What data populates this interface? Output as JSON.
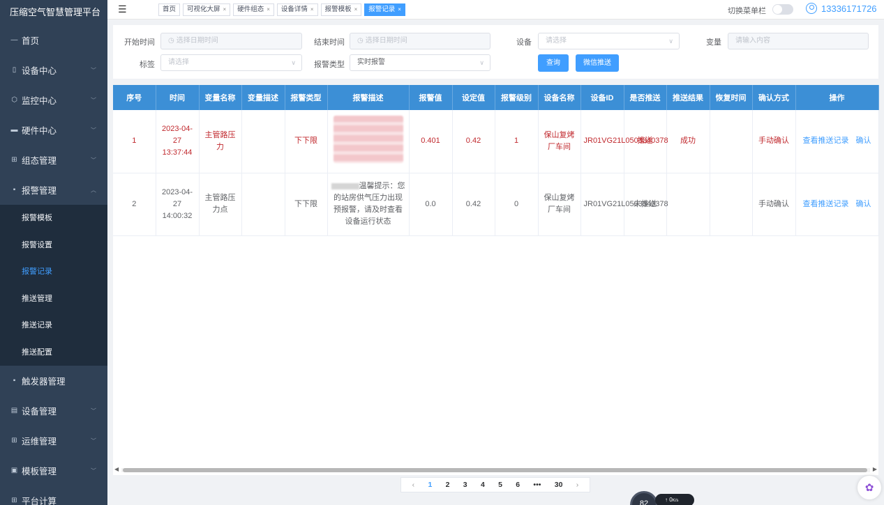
{
  "app": {
    "title": "压缩空气智慧管理平台"
  },
  "sidebar": {
    "items": [
      {
        "label": "首页",
        "icon": "—",
        "has_children": false
      },
      {
        "label": "设备中心",
        "icon": "▯",
        "has_children": true
      },
      {
        "label": "监控中心",
        "icon": "⬡",
        "has_children": true
      },
      {
        "label": "硬件中心",
        "icon": "▬",
        "has_children": true
      },
      {
        "label": "组态管理",
        "icon": "⊞",
        "has_children": true
      },
      {
        "label": "报警管理",
        "icon": "▪",
        "has_children": true,
        "expanded": true
      }
    ],
    "sub_items": [
      {
        "label": "报警模板",
        "active": false
      },
      {
        "label": "报警设置",
        "active": false
      },
      {
        "label": "报警记录",
        "active": true
      },
      {
        "label": "推送管理",
        "active": false
      },
      {
        "label": "推送记录",
        "active": false
      },
      {
        "label": "推送配置",
        "active": false
      }
    ],
    "items_after": [
      {
        "label": "触发器管理",
        "icon": "▪",
        "has_children": false
      },
      {
        "label": "设备管理",
        "icon": "▤",
        "has_children": true
      },
      {
        "label": "运维管理",
        "icon": "⊞",
        "has_children": true
      },
      {
        "label": "模板管理",
        "icon": "▣",
        "has_children": true
      },
      {
        "label": "平台计算",
        "icon": "⊞",
        "has_children": false
      }
    ]
  },
  "topbar": {
    "tags": [
      {
        "label": "首页",
        "closable": false,
        "active": false
      },
      {
        "label": "可视化大屏",
        "closable": true,
        "active": false
      },
      {
        "label": "硬件组态",
        "closable": true,
        "active": false
      },
      {
        "label": "设备详情",
        "closable": true,
        "active": false
      },
      {
        "label": "报警模板",
        "closable": true,
        "active": false
      },
      {
        "label": "报警记录",
        "closable": true,
        "active": true
      }
    ],
    "switch_label": "切换菜单栏",
    "username": "13336171726"
  },
  "filters": {
    "start_time_label": "开始时间",
    "start_time_placeholder": "选择日期时间",
    "end_time_label": "结束时间",
    "end_time_placeholder": "选择日期时间",
    "device_label": "设备",
    "device_placeholder": "请选择",
    "variable_label": "变量",
    "variable_placeholder": "请输入内容",
    "tag_label": "标签",
    "tag_placeholder": "请选择",
    "alarm_type_label": "报警类型",
    "alarm_type_value": "实时报警",
    "query_button": "查询",
    "wechat_button": "微信推送"
  },
  "table": {
    "columns": [
      "序号",
      "时间",
      "变量名称",
      "变量描述",
      "报警类型",
      "报警描述",
      "报警值",
      "设定值",
      "报警级别",
      "设备名称",
      "设备ID",
      "是否推送",
      "推送结果",
      "恢复时间",
      "确认方式",
      "操作"
    ],
    "rows": [
      {
        "index": "1",
        "time": "2023-04-27 13:37:44",
        "var_name": "主管路压力",
        "var_desc": "",
        "alarm_type": "下下限",
        "alarm_desc": "",
        "alarm_value": "0.401",
        "set_value": "0.42",
        "level": "1",
        "device_name": "保山复烤厂车间",
        "device_id": "JR01VG21L0503340378",
        "pushed": "推送",
        "push_result": "成功",
        "recover_time": "",
        "confirm": "手动确认",
        "action_view": "查看推送记录",
        "action_confirm": "确认"
      },
      {
        "index": "2",
        "time": "2023-04-27 14:00:32",
        "var_name": "主管路压力点",
        "var_desc": "",
        "alarm_type": "下下限",
        "alarm_desc": "温馨提示：您的站房供气压力出现预报警，请及时查看设备运行状态",
        "alarm_value": "0.0",
        "set_value": "0.42",
        "level": "0",
        "device_name": "保山复烤厂车间",
        "device_id": "JR01VG21L0503340378",
        "pushed": "未推送",
        "push_result": "",
        "recover_time": "",
        "confirm": "手动确认",
        "action_view": "查看推送记录",
        "action_confirm": "确认"
      }
    ]
  },
  "pagination": {
    "prev": "‹",
    "pages": [
      "1",
      "2",
      "3",
      "4",
      "5",
      "6",
      "•••",
      "30"
    ],
    "current": "1",
    "next": "›"
  },
  "widgets": {
    "speed_value": "0",
    "speed_unit": "K/s",
    "dial_value": "82"
  },
  "colors": {
    "sidebar_bg": "#304156",
    "accent": "#409eff",
    "header_bg": "#3c8fd6",
    "alarm_red": "#c0282d"
  }
}
